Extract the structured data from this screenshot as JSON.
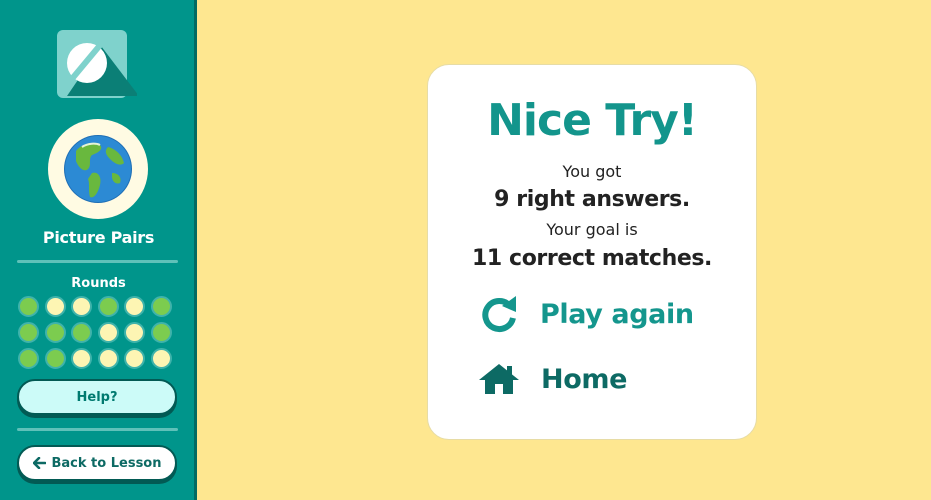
{
  "sidebar": {
    "app_title": "Picture Pairs",
    "rounds_label": "Rounds",
    "rounds": [
      "done",
      "todo",
      "todo",
      "done",
      "todo",
      "done",
      "done",
      "done",
      "done",
      "todo",
      "todo",
      "done",
      "done",
      "done",
      "todo",
      "todo",
      "todo",
      "todo"
    ],
    "help_label": "Help?",
    "back_label": "Back to Lesson",
    "icons": {
      "logo": "app-logo",
      "lesson": "globe-icon",
      "back": "arrow-left-icon"
    }
  },
  "result": {
    "headline": "Nice Try!",
    "got_prefix": "You got",
    "got_value": "9 right answers.",
    "goal_prefix": "Your goal is",
    "goal_value": "11 correct matches.",
    "play_again_label": "Play again",
    "home_label": "Home",
    "icons": {
      "play_again": "refresh-icon",
      "home": "home-icon"
    }
  },
  "colors": {
    "sidebar": "#00958b",
    "background": "#fee790",
    "accent": "#13958c",
    "round_done": "#7ccc4f",
    "round_todo": "#fdf5b3"
  }
}
